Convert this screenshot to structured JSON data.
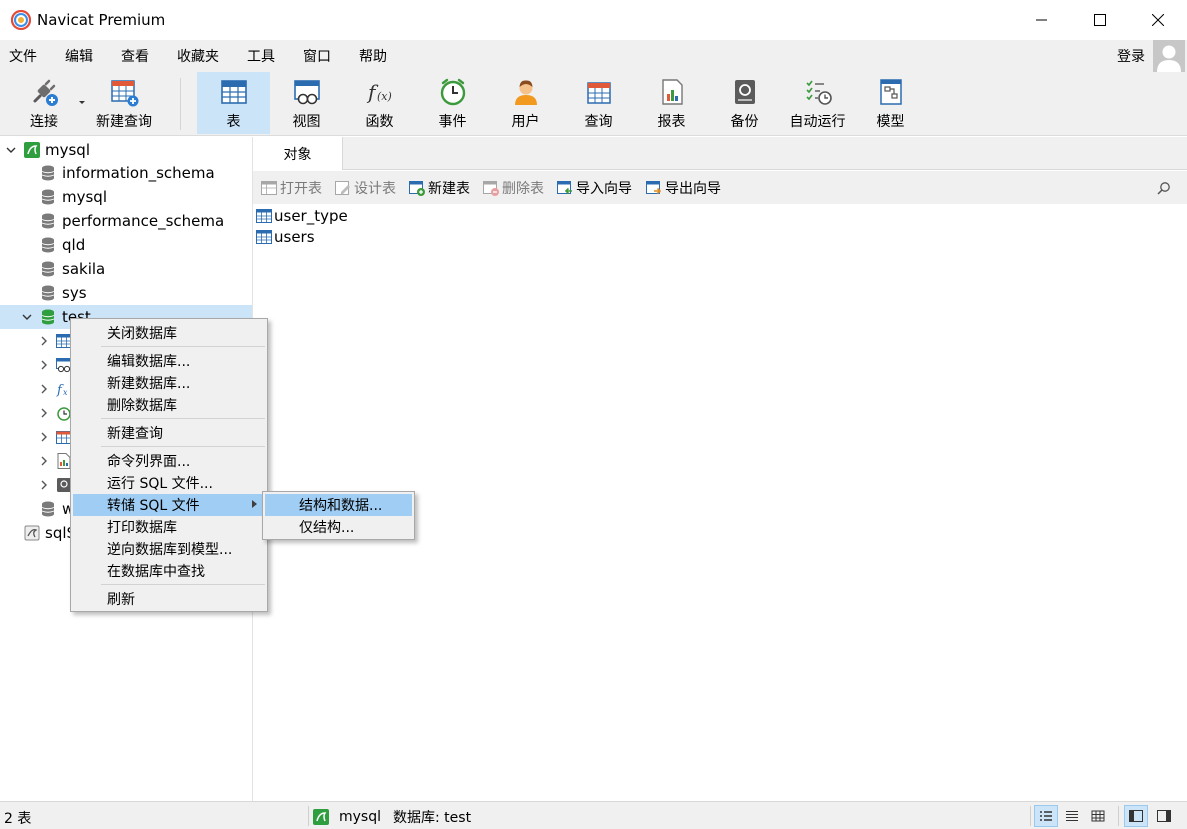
{
  "window": {
    "title": "Navicat Premium"
  },
  "menubar": {
    "items": [
      "文件",
      "编辑",
      "查看",
      "收藏夹",
      "工具",
      "窗口",
      "帮助"
    ],
    "login": "登录"
  },
  "toolbar": {
    "connect": "连接",
    "new_query": "新建查询",
    "table": "表",
    "view": "视图",
    "function": "函数",
    "event": "事件",
    "user": "用户",
    "query": "查询",
    "report": "报表",
    "backup": "备份",
    "automation": "自动运行",
    "model": "模型"
  },
  "nav": {
    "connection": "mysql",
    "databases": [
      "information_schema",
      "mysql",
      "performance_schema",
      "qld",
      "sakila",
      "sys",
      "test"
    ],
    "partial_db": "w",
    "second_connection": "sqlS"
  },
  "content": {
    "tab": "对象",
    "actions": {
      "open": "打开表",
      "design": "设计表",
      "new": "新建表",
      "delete": "删除表",
      "import": "导入向导",
      "export": "导出向导"
    },
    "tables": [
      "user_type",
      "users"
    ]
  },
  "context_menu": {
    "items": [
      "关闭数据库",
      "编辑数据库...",
      "新建数据库...",
      "删除数据库",
      "新建查询",
      "命令列界面...",
      "运行 SQL 文件...",
      "转储 SQL 文件",
      "打印数据库",
      "逆向数据库到模型...",
      "在数据库中查找",
      "刷新"
    ],
    "submenu": [
      "结构和数据...",
      "仅结构..."
    ]
  },
  "statusbar": {
    "count": "2 表",
    "connection": "mysql",
    "database": "数据库: test"
  },
  "colors": {
    "selection": "#cce4f7",
    "menu_highlight": "#9fcdf4",
    "db_green": "#2e9e3e"
  }
}
